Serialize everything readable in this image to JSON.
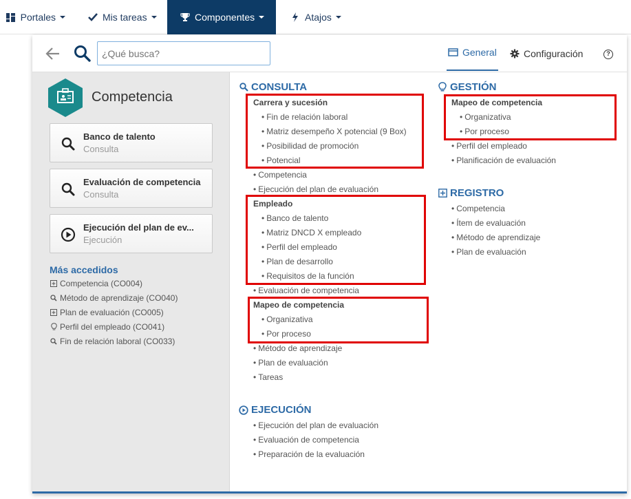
{
  "nav": {
    "portales": "Portales",
    "mis_tareas": "Mis tareas",
    "componentes": "Componentes",
    "atajos": "Atajos"
  },
  "search": {
    "placeholder": "¿Qué busca?"
  },
  "tabs": {
    "general": "General",
    "configuracion": "Configuración"
  },
  "component": {
    "title": "Competencia"
  },
  "cards": [
    {
      "title": "Banco de talento",
      "subtitle": "Consulta"
    },
    {
      "title": "Evaluación de competencia",
      "subtitle": "Consulta"
    },
    {
      "title": "Ejecución del plan de ev...",
      "subtitle": "Ejecución"
    }
  ],
  "mas_accedidos": {
    "title": "Más accedidos",
    "items": [
      "Competencia (CO004)",
      "Método de aprendizaje (CO040)",
      "Plan de evaluación (CO005)",
      "Perfil del empleado (CO041)",
      "Fin de relación laboral (CO033)"
    ]
  },
  "consulta": {
    "title": "CONSULTA",
    "group1": {
      "label": "Carrera y sucesión",
      "items": [
        "Fin de relación laboral",
        "Matriz desempeño X potencial (9 Box)",
        "Posibilidad de promoción",
        "Potencial"
      ]
    },
    "mid1": [
      "Competencia",
      "Ejecución del plan de evaluación"
    ],
    "group2": {
      "label": "Empleado",
      "items": [
        "Banco de talento",
        "Matriz DNCD X empleado",
        "Perfil del empleado",
        "Plan de desarrollo",
        "Requisitos de la función"
      ]
    },
    "mid2": [
      "Evaluación de competencia"
    ],
    "group3": {
      "label": "Mapeo de competencia",
      "items": [
        "Organizativa",
        "Por proceso"
      ]
    },
    "tail": [
      "Método de aprendizaje",
      "Plan de evaluación",
      "Tareas"
    ]
  },
  "ejecucion": {
    "title": "EJECUCIÓN",
    "items": [
      "Ejecución del plan de evaluación",
      "Evaluación de competencia",
      "Preparación de la evaluación"
    ]
  },
  "gestion": {
    "title": "GESTIÓN",
    "group": {
      "label": "Mapeo de competencia",
      "items": [
        "Organizativa",
        "Por proceso"
      ]
    },
    "items": [
      "Perfil del empleado",
      "Planificación de evaluación"
    ]
  },
  "registro": {
    "title": "REGISTRO",
    "items": [
      "Competencia",
      "Ítem de evaluación",
      "Método de aprendizaje",
      "Plan de evaluación"
    ]
  },
  "colors": {
    "accent": "#2d6aa6",
    "nav_active": "#0d3b66",
    "highlight": "#e00000",
    "hex": "#1a8a8c"
  }
}
